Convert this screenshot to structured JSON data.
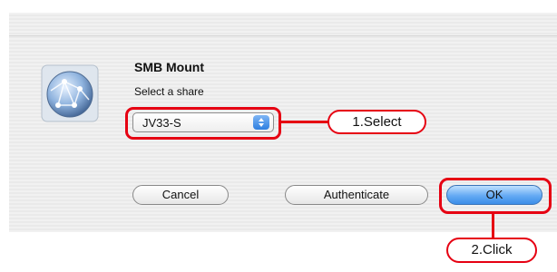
{
  "dialog": {
    "title": "SMB Mount",
    "subtitle": "Select a share",
    "share_select": {
      "value": "JV33-S"
    },
    "buttons": {
      "cancel": "Cancel",
      "authenticate": "Authenticate",
      "ok": "OK"
    },
    "icon": "network-globe-icon"
  },
  "annotations": {
    "step1": "1.Select",
    "step2": "2.Click",
    "color": "#e60012"
  }
}
